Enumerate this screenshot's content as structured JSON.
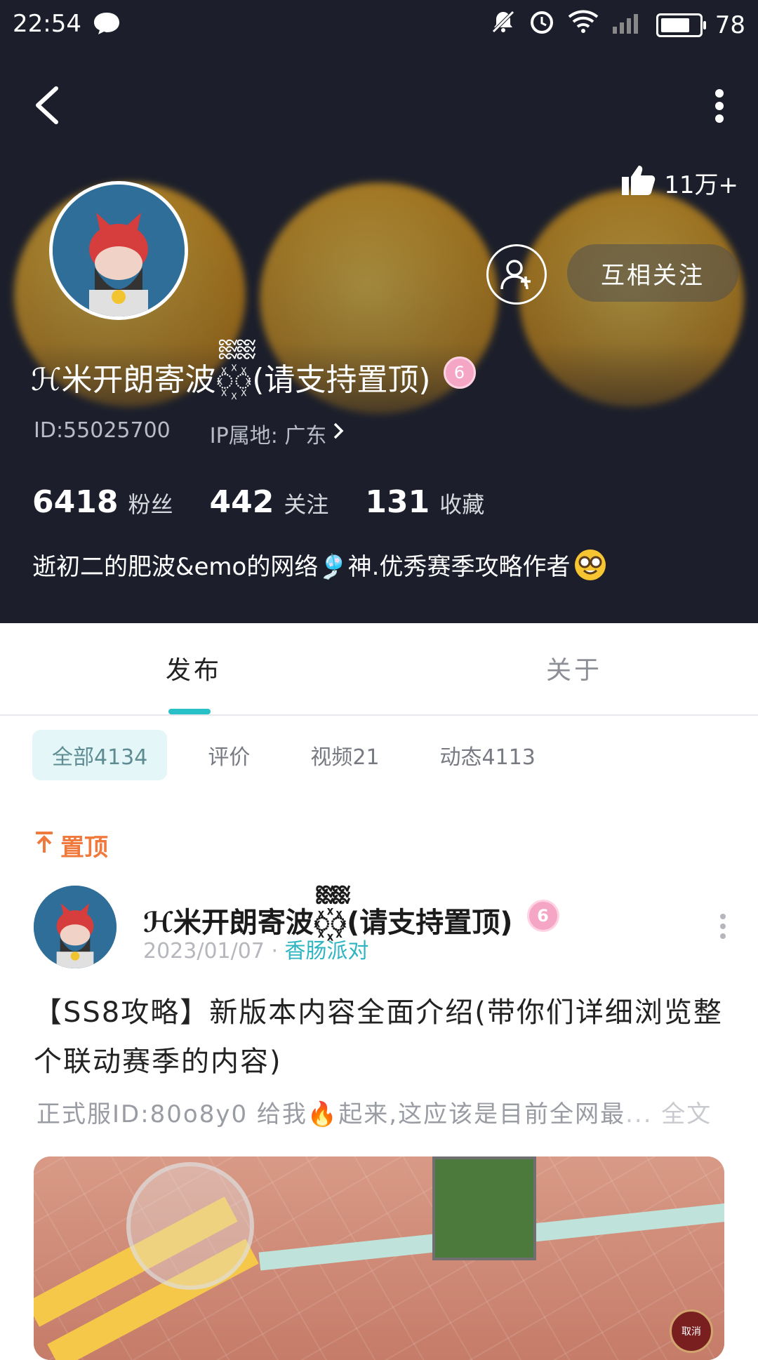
{
  "status_bar": {
    "time": "22:54",
    "battery": "78",
    "battery_level": 0.78
  },
  "profile": {
    "likes": "11万+",
    "follow_status": "互相关注",
    "username": "ℋ米开朗寄波ᢆ꙰ᢆ(请支持置顶)",
    "badge": "6",
    "id_text": "ID:55025700",
    "ip_text": "IP属地: 广东",
    "stats": [
      {
        "num": "6418",
        "label": "粉丝"
      },
      {
        "num": "442",
        "label": "关注"
      },
      {
        "num": "131",
        "label": "收藏"
      }
    ],
    "bio": "逝初二的肥波&emo的网络🎐神.优秀赛季攻略作者"
  },
  "tabs": {
    "active": "发布",
    "inactive": "关于"
  },
  "filters": [
    "全部4134",
    "评价",
    "视频21",
    "动态4113"
  ],
  "pinned_label": "置顶",
  "post": {
    "author": "ℋ米开朗寄波ᢆ꙰ᢆ(请支持置顶)",
    "badge": "6",
    "date": "2023/01/07",
    "sep": " · ",
    "category": "香肠派对",
    "title": "【SS8攻略】新版本内容全面介绍(带你们详细浏览整个联动赛季的内容)",
    "excerpt_before": "正式服ID:80o8y0 给我",
    "excerpt_emoji": "🔥",
    "excerpt_after": "起来,这应该是目前全网最",
    "excerpt_more": "... 全文",
    "image_cancel_label": "取消"
  },
  "colors": {
    "header_bg": "#1c1f2b",
    "accent": "#26c0c6",
    "pinned": "#f07a3e",
    "category": "#2fb4c2"
  },
  "icons": [
    "chat-bubble-icon",
    "mute-icon",
    "alarm-icon",
    "wifi-icon",
    "signal-icon",
    "back-arrow-icon",
    "more-vertical-icon",
    "thumbs-up-icon",
    "add-user-icon",
    "chevron-right-icon",
    "pin-icon",
    "nerd-face-icon"
  ]
}
